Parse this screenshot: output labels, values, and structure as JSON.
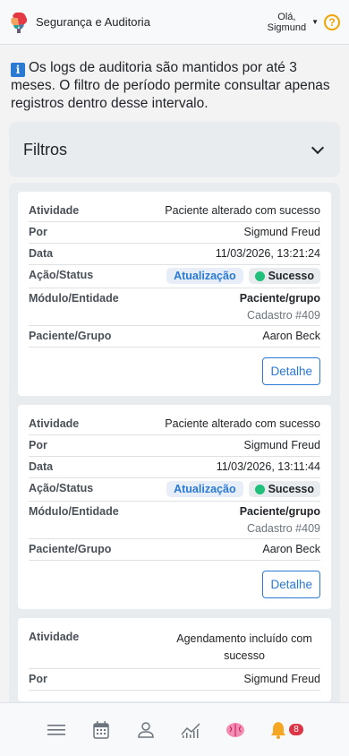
{
  "header": {
    "app_title": "Segurança e Auditoria",
    "greeting": "Olá,",
    "user_name": "Sigmund",
    "help_symbol": "?"
  },
  "notice": {
    "text": "Os logs de auditoria são mantidos por até 3 meses. O filtro de período permite consultar apenas registros dentro desse intervalo."
  },
  "filters": {
    "label": "Filtros"
  },
  "labels": {
    "activity": "Atividade",
    "by": "Por",
    "date": "Data",
    "action_status": "Ação/Status",
    "module_entity": "Módulo/Entidade",
    "patient_group": "Paciente/Grupo",
    "detail_button": "Detalhe"
  },
  "logs": [
    {
      "activity": "Paciente alterado com sucesso",
      "by": "Sigmund Freud",
      "date": "11/03/2026, 13:21:24",
      "action": "Atualização",
      "status": "Sucesso",
      "module": "Paciente/grupo",
      "entity": "Cadastro #409",
      "patient_group": "Aaron Beck"
    },
    {
      "activity": "Paciente alterado com sucesso",
      "by": "Sigmund Freud",
      "date": "11/03/2026, 13:11:44",
      "action": "Atualização",
      "status": "Sucesso",
      "module": "Paciente/grupo",
      "entity": "Cadastro #409",
      "patient_group": "Aaron Beck"
    },
    {
      "activity": "Agendamento incluído com sucesso",
      "by": "Sigmund Freud"
    }
  ],
  "bottom_nav": {
    "items": [
      "menu-icon",
      "calendar-icon",
      "user-icon",
      "chart-icon",
      "brain-icon",
      "bell-icon"
    ],
    "notifications_count": "8"
  },
  "colors": {
    "accent": "#2a7ad4",
    "success": "#20c07a",
    "danger": "#dc3545",
    "warning": "#f0a500"
  }
}
